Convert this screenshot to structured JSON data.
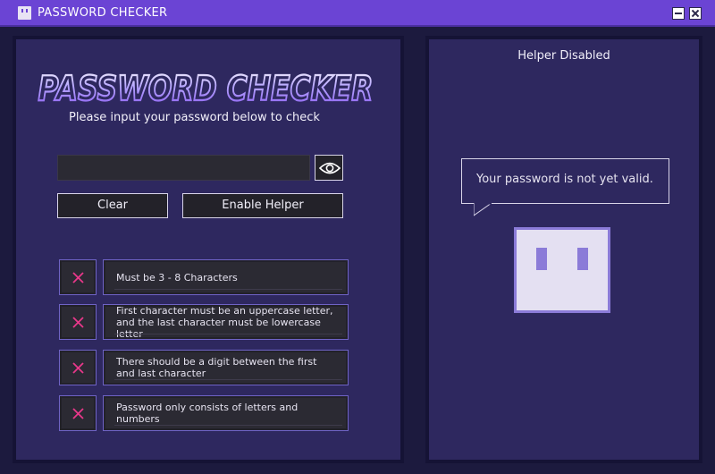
{
  "window": {
    "title": "PASSWORD CHECKER",
    "icon": "app-face-icon",
    "controls": [
      "minimize-icon",
      "close-icon"
    ]
  },
  "checker": {
    "logo_text": "PASSWORD CHECKER",
    "subtitle": "Please input your password below to check",
    "password": {
      "value": "",
      "placeholder": ""
    },
    "toggle_visibility_icon": "eye-icon",
    "clear_label": "Clear",
    "helper_toggle_label": "Enable Helper",
    "rules": [
      {
        "text": "Must be 3 - 8 Characters",
        "status": "fail",
        "icon": "x-icon"
      },
      {
        "text": "First character must be an uppercase letter, and the last character must be lowercase letter",
        "status": "fail",
        "icon": "x-icon"
      },
      {
        "text": "There should be a digit between the first and last character",
        "status": "fail",
        "icon": "x-icon"
      },
      {
        "text": "Password only consists of letters and numbers",
        "status": "fail",
        "icon": "x-icon"
      }
    ]
  },
  "helper": {
    "status": "Helper Disabled",
    "message": "Your password is not yet valid."
  },
  "colors": {
    "titlebar": "#6b44d4",
    "panel": "#2e285f",
    "background": "#1c1a3e",
    "fail_x": "#e8388a",
    "accent_border": "#6f63c6",
    "mascot_body": "#e4e0f2",
    "mascot_accent": "#8b7bd8"
  }
}
